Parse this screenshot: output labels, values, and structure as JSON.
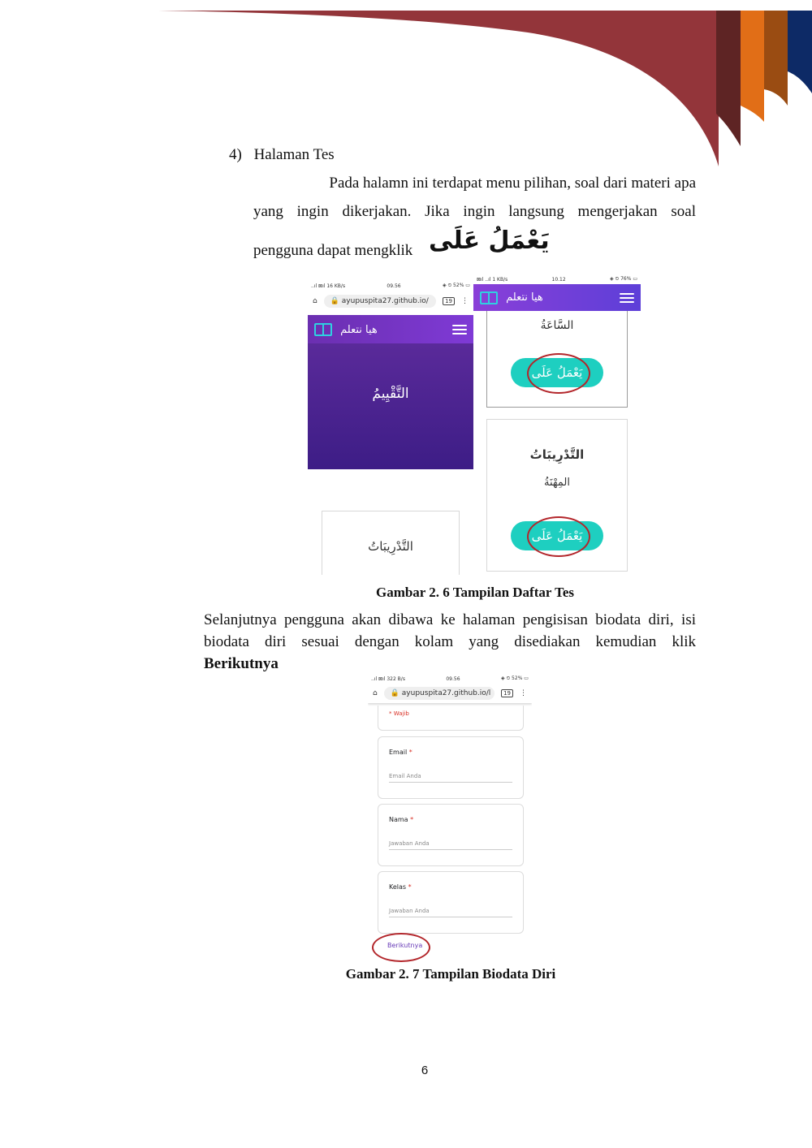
{
  "header": {
    "colors": {
      "maroon": "#93353a",
      "dark": "#5e2424",
      "orange": "#e16e17",
      "brown": "#9a4c12",
      "navy": "#0d2a66"
    }
  },
  "section": {
    "heading_number": "4)",
    "heading_text": "Halaman Tes",
    "para1_line1": "Pada halamn ini terdapat menu pilihan, soal dari materi apa",
    "para1_line2": "yang ingin dikerjakan. Jika ingin langsung mengerjakan soal",
    "para1_line3": "pengguna dapat mengklik",
    "arabic_inline": "يَعْمَلُ عَلَى"
  },
  "figure1": {
    "left_phone": {
      "status_left": "..ıl ⊠ıl 16 KB/s",
      "status_time": "09.56",
      "status_right": "◈ ⏲ 52% ▭",
      "url": "ayupuspita27.github.io/",
      "tab_count": "19",
      "app_title": "هيا نتعلم",
      "hero_text": "التَّقْيِيمُ",
      "card_title": "التَّدْرِيبَاتُ"
    },
    "right_phone": {
      "status_left": "⊠ıl ..ıl 1 KB/s",
      "status_time": "10.12",
      "status_right": "◈ ⏲ 76% ▭",
      "app_title": "هيا نتعلم",
      "card1_subtitle": "السَّاعَةُ",
      "card1_button": "يَعْمَلُ عَلَى",
      "card2_title": "التَّدْرِيبَاتُ",
      "card2_subtitle": "المِهْنَةُ",
      "card2_button": "يَعْمَلُ عَلَى"
    },
    "caption": "Gambar 2. 6 Tampilan Daftar Tes"
  },
  "para2": {
    "line1": "Selanjutnya pengguna akan dibawa ke halaman pengisisan biodata diri, isi",
    "line2": "biodata diri sesuai dengan kolam yang disediakan kemudian klik",
    "line3_bold": "Berikutnya"
  },
  "figure2": {
    "status_left": "..ıl ⊠ıl 322 B/s",
    "status_time": "09.56",
    "status_right": "◈ ⏲ 52% ▭",
    "url": "ayupuspita27.github.io/l",
    "tab_count": "19",
    "required_note": "* Wajib",
    "fields": [
      {
        "label": "Email",
        "required": "*",
        "placeholder": "Email Anda"
      },
      {
        "label": "Nama",
        "required": "*",
        "placeholder": "Jawaban Anda"
      },
      {
        "label": "Kelas",
        "required": "*",
        "placeholder": "Jawaban Anda"
      }
    ],
    "next_button": "Berikutnya",
    "caption": "Gambar 2. 7 Tampilan Biodata Diri"
  },
  "page_number": "6"
}
